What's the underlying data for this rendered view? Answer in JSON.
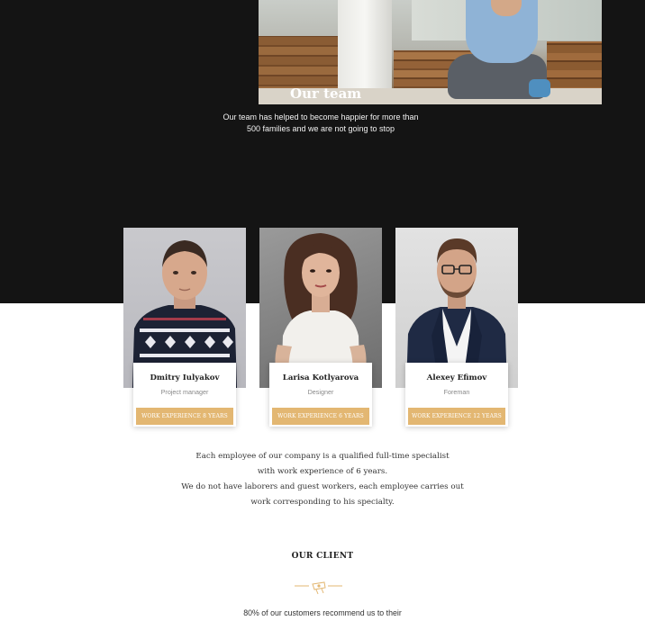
{
  "hero": {
    "title": "Our team",
    "subtitle_line1": "Our team has helped to become happier for more than",
    "subtitle_line2": "500 families and we are not going to stop"
  },
  "team": [
    {
      "name": "Dmitry Iulyakov",
      "role": "Project manager",
      "experience": "WORK EXPERIENCE 8 YEARS"
    },
    {
      "name": "Larisa Kotlyarova",
      "role": "Designer",
      "experience": "WORK EXPERIENCE 6 YEARS"
    },
    {
      "name": "Alexey Efimov",
      "role": "Foreman",
      "experience": "WORK EXPERIENCE 12 YEARS"
    }
  ],
  "description": {
    "line1": "Each employee of our company is a qualified full-time specialist",
    "line2": "with work experience of 6 years.",
    "line3": "We do not have laborers and guest workers, each employee carries out",
    "line4": "work corresponding to his specialty."
  },
  "client": {
    "title": "OUR CLIENT",
    "subtitle": "80% of our customers recommend us to their"
  },
  "colors": {
    "dark_background": "#141414",
    "accent_gold": "#e3b772"
  },
  "icons": [
    "decorative-divider-icon"
  ]
}
